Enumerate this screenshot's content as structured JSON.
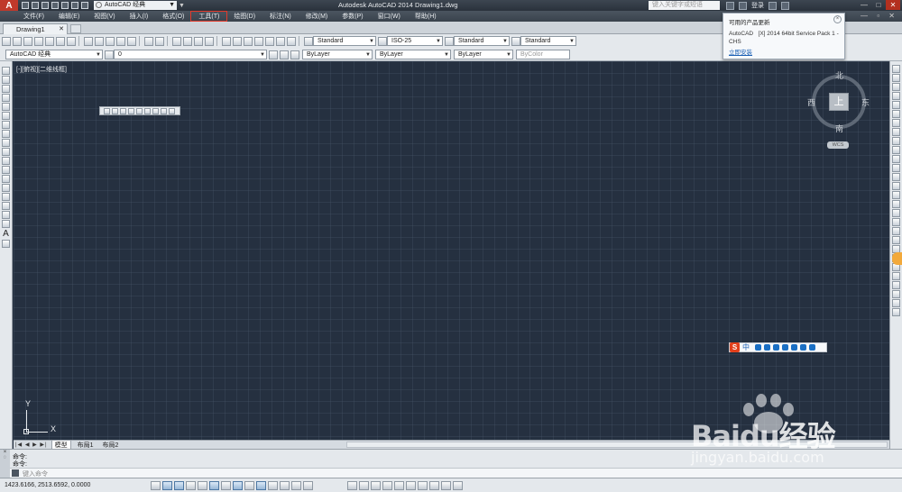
{
  "titlebar": {
    "app_logo": "A",
    "workspace": "AutoCAD 经典",
    "title": "Autodesk AutoCAD 2014    Drawing1.dwg",
    "search_placeholder": "键入关键字或短语",
    "login": "登录"
  },
  "menu": {
    "items": [
      "文件(F)",
      "编辑(E)",
      "视图(V)",
      "插入(I)",
      "格式(O)",
      "工具(T)",
      "绘图(D)",
      "标注(N)",
      "修改(M)",
      "参数(P)",
      "窗口(W)",
      "帮助(H)"
    ],
    "highlighted_index": 5
  },
  "doc_tab": {
    "label": "Drawing1"
  },
  "toolbars": {
    "text_style": "Standard",
    "dim_style": "ISO-25",
    "table_style": "Standard",
    "multileader_style": "Standard",
    "workspace2": "AutoCAD 经典",
    "layer": "0",
    "color": "ByLayer",
    "linetype": "ByLayer",
    "lineweight": "ByLayer",
    "plotstyle": "ByColor"
  },
  "balloon": {
    "title": "可用的产品更新",
    "body": "AutoCAD   [X] 2014 64bit Service Pack 1 - CHS",
    "link": "立即安装"
  },
  "drawing": {
    "view_label": "[-][俯视][二维线框]",
    "viewcube": {
      "north": "北",
      "south": "南",
      "east": "东",
      "west": "西",
      "face": "上",
      "wcs": "WCS"
    },
    "ucs": {
      "x": "X",
      "y": "Y"
    },
    "ime": {
      "logo": "S",
      "lang": "中"
    }
  },
  "layout_tabs": {
    "nav": "|◀ ◀ ▶ ▶|",
    "tabs": [
      "模型",
      "布局1",
      "布局2"
    ]
  },
  "command": {
    "side_close": "×",
    "side_gear": "◌",
    "line1": "命令:",
    "line2": "命令:",
    "prompt": "键入命令"
  },
  "status": {
    "coordinates": "1423.6166,  2513.6592,  0.0000"
  },
  "watermark": {
    "brand": "Baidu",
    "suffix": "经验",
    "url": "jingyan.baidu.com"
  }
}
